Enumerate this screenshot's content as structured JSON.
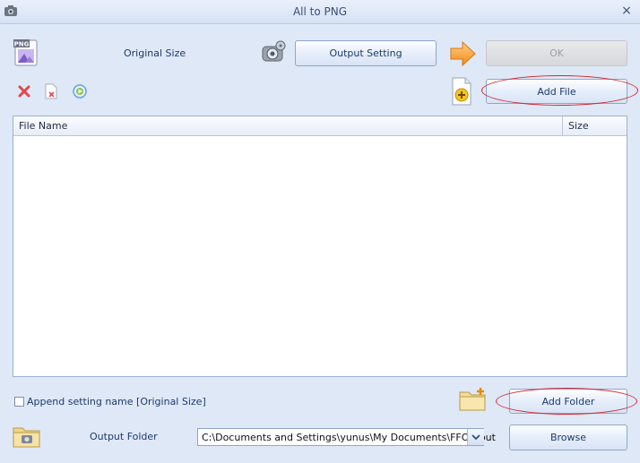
{
  "window": {
    "title": "All to PNG",
    "close_glyph": "×"
  },
  "top": {
    "format_icon_text": "PNG",
    "size_label": "Original Size",
    "output_setting_label": "Output Setting",
    "ok_label": "OK"
  },
  "toolbar": {
    "add_file_label": "Add File"
  },
  "file_list": {
    "columns": [
      "File Name",
      "Size"
    ],
    "rows": []
  },
  "bottom": {
    "append_label": "Append setting name [Original Size]",
    "append_checked": false,
    "add_folder_label": "Add Folder",
    "output_folder_label": "Output Folder",
    "output_folder_value": "C:\\Documents and Settings\\yunus\\My Documents\\FFOutput",
    "browse_label": "Browse"
  },
  "colors": {
    "background": "#dfe8f6",
    "annotation_red": "#d2262f",
    "arrow_orange": "#f7a93a",
    "delete_red": "#e0474c"
  }
}
